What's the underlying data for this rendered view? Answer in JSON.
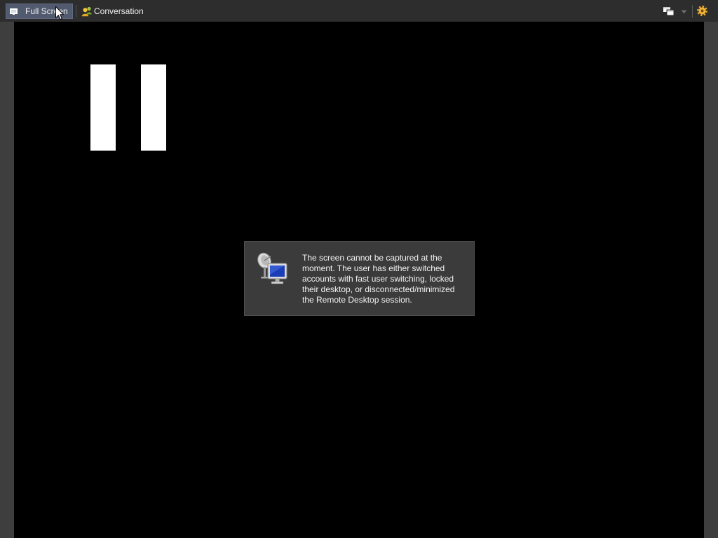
{
  "toolbar": {
    "full_screen_label": "Full Screen",
    "full_screen_icon": "monitor-icon",
    "conversation_label": "Conversation",
    "conversation_icon": "users-icon",
    "view_mode_icon": "windows-icon",
    "view_mode_dropdown_icon": "chevron-down-icon",
    "settings_icon": "gear-icon"
  },
  "remote_screen": {
    "indicator_icon": "pause-icon"
  },
  "message": {
    "icon": "remote-desktop-icon",
    "lines": [
      "The screen cannot be captured at the",
      "moment. The user has either switched",
      "accounts with fast user switching, locked",
      "their desktop, or disconnected/minimized",
      "the Remote Desktop session."
    ]
  },
  "colors": {
    "toolbar_background": "#2d2d2d",
    "active_button": "#515a6f",
    "frame_background": "#3e3e3e",
    "viewport_background": "#000000",
    "message_background": "#3b3b3b",
    "gear_accent": "#e6a52a"
  }
}
